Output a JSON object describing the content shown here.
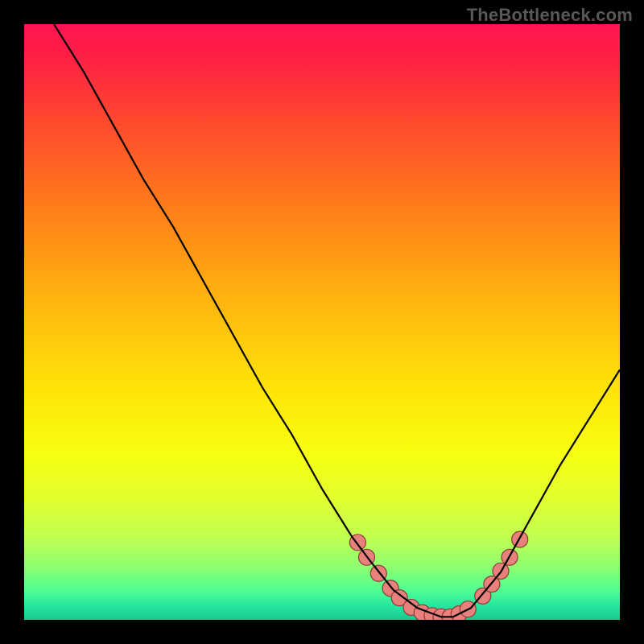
{
  "watermark": "TheBottleneck.com",
  "chart_data": {
    "type": "line",
    "title": "",
    "xlabel": "",
    "ylabel": "",
    "xlim": [
      0,
      100
    ],
    "ylim": [
      0,
      100
    ],
    "grid": false,
    "legend": false,
    "gradient_stops": [
      {
        "offset": 0.0,
        "color": "#ff1452"
      },
      {
        "offset": 0.05,
        "color": "#ff1e46"
      },
      {
        "offset": 0.15,
        "color": "#ff4430"
      },
      {
        "offset": 0.3,
        "color": "#ff7a1a"
      },
      {
        "offset": 0.45,
        "color": "#ffb010"
      },
      {
        "offset": 0.6,
        "color": "#ffe008"
      },
      {
        "offset": 0.72,
        "color": "#f8ff10"
      },
      {
        "offset": 0.8,
        "color": "#e0ff30"
      },
      {
        "offset": 0.86,
        "color": "#c0ff50"
      },
      {
        "offset": 0.91,
        "color": "#90ff70"
      },
      {
        "offset": 0.95,
        "color": "#50ff90"
      },
      {
        "offset": 0.975,
        "color": "#28e8a0"
      },
      {
        "offset": 1.0,
        "color": "#18c890"
      }
    ],
    "series": [
      {
        "name": "curve",
        "stroke": "#000000",
        "x": [
          5,
          10,
          15,
          20,
          25,
          30,
          35,
          40,
          45,
          50,
          55,
          58,
          62,
          66,
          70,
          72,
          75,
          80,
          85,
          90,
          95,
          100
        ],
        "y": [
          100,
          92,
          83,
          74,
          66,
          57,
          48,
          39,
          31,
          22,
          14,
          10,
          5,
          2,
          0.5,
          0.5,
          2,
          8,
          17,
          26,
          34,
          42
        ]
      }
    ],
    "highlight_points": {
      "name": "markers",
      "color": "#e8817c",
      "stroke": "#8a3a36",
      "radius": 10,
      "points": [
        {
          "x": 56,
          "y": 13
        },
        {
          "x": 57.5,
          "y": 10.5
        },
        {
          "x": 59.5,
          "y": 7.8
        },
        {
          "x": 61.5,
          "y": 5.3
        },
        {
          "x": 63,
          "y": 3.7
        },
        {
          "x": 65,
          "y": 2.1
        },
        {
          "x": 66.8,
          "y": 1.2
        },
        {
          "x": 68.5,
          "y": 0.7
        },
        {
          "x": 70,
          "y": 0.5
        },
        {
          "x": 71.5,
          "y": 0.5
        },
        {
          "x": 73,
          "y": 1.0
        },
        {
          "x": 74.5,
          "y": 1.8
        },
        {
          "x": 77,
          "y": 4.0
        },
        {
          "x": 78.5,
          "y": 6.0
        },
        {
          "x": 80,
          "y": 8.2
        },
        {
          "x": 81.5,
          "y": 10.5
        },
        {
          "x": 83.2,
          "y": 13.5
        }
      ]
    }
  }
}
